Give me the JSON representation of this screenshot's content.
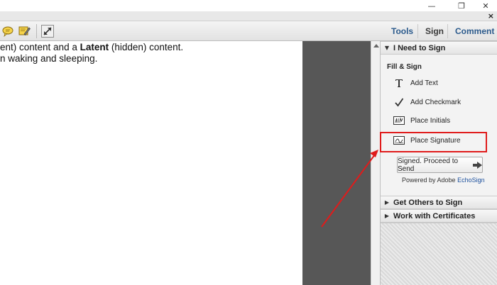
{
  "window": {
    "minimize_glyph": "—",
    "restore_glyph": "❐",
    "close_glyph": "✕",
    "panel_close_glyph": "×"
  },
  "toolbar": {
    "icons": [
      "speech-bubble-comment-icon",
      "sticky-note-pencil-icon",
      "expand-arrows-icon"
    ],
    "tabs": {
      "tools": "Tools",
      "sign": "Sign",
      "comment": "Comment"
    },
    "colors": {
      "tab_text": "#2b5a8c",
      "active_tab_text": "#3a3a3a"
    }
  },
  "document": {
    "line1": {
      "before": "ent) content and a ",
      "bold": "Latent",
      "after": " (hidden) content."
    },
    "line2": "n waking and sleeping."
  },
  "sign_panel": {
    "section_i_need_to_sign": "I Need to Sign",
    "fill_sign_title": "Fill & Sign",
    "items": [
      {
        "label": "Add Text",
        "icon": "text-T-icon"
      },
      {
        "label": "Add Checkmark",
        "icon": "checkmark-icon"
      },
      {
        "label": "Place Initials",
        "icon": "initials-icon"
      },
      {
        "label": "Place Signature",
        "icon": "signature-pen-icon"
      }
    ],
    "send_button": "Signed. Proceed to Send",
    "powered_by": "Powered by Adobe ",
    "powered_brand": "EchoSign",
    "section_get_others": "Get Others to Sign",
    "section_certificates": "Work with Certificates"
  },
  "annotation": {
    "color": "#e01b1b",
    "target": "Place Signature"
  }
}
